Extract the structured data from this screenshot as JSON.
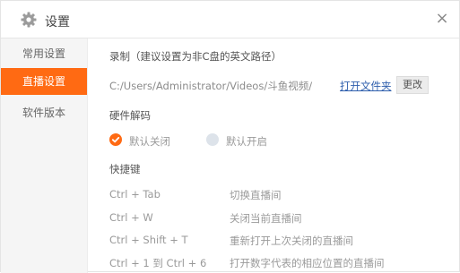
{
  "window": {
    "title": "设置",
    "title_icon": "gear-icon",
    "close_icon": "close-icon",
    "close_glyph": "×"
  },
  "sidebar": {
    "items": [
      {
        "label": "常用设置",
        "active": false
      },
      {
        "label": "直播设置",
        "active": true
      },
      {
        "label": "软件版本",
        "active": false
      }
    ]
  },
  "recording": {
    "heading": "录制（建议设置为非C盘的英文路径）",
    "path": "C:/Users/Administrator/Videos/斗鱼视频/",
    "open_folder_label": "打开文件夹",
    "change_label": "更改"
  },
  "hardware_decode": {
    "heading": "硬件解码",
    "options": [
      {
        "label": "默认关闭",
        "selected": true
      },
      {
        "label": "默认开启",
        "selected": false
      }
    ]
  },
  "shortcuts": {
    "heading": "快捷键",
    "items": [
      {
        "keys": "Ctrl + Tab",
        "action": "切换直播间"
      },
      {
        "keys": "Ctrl + W",
        "action": "关闭当前直播间"
      },
      {
        "keys": "Ctrl + Shift + T",
        "action": "重新打开上次关闭的直播间"
      },
      {
        "keys": "Ctrl + 1 到 Ctrl + 6",
        "action": "打开数字代表的相应位置的直播间"
      }
    ]
  },
  "colors": {
    "accent": "#ff6a13",
    "link": "#2f5fad",
    "sidebar_bg": "#f5f5f5"
  }
}
